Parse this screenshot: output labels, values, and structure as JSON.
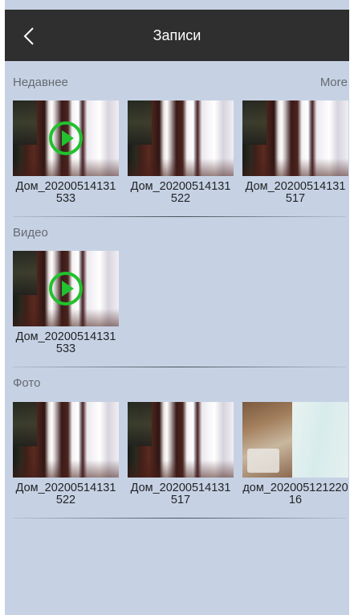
{
  "header": {
    "title": "Записи",
    "back_icon": "chevron-left-icon"
  },
  "recent": {
    "title": "Недавнее",
    "more_label": "More",
    "items": [
      {
        "caption": "Дом_20200514131533",
        "type": "video"
      },
      {
        "caption": "Дом_20200514131522",
        "type": "photo"
      },
      {
        "caption": "Дом_20200514131517",
        "type": "photo"
      }
    ]
  },
  "video": {
    "title": "Видео",
    "items": [
      {
        "caption": "Дом_20200514131533",
        "type": "video"
      }
    ]
  },
  "photo": {
    "title": "Фото",
    "items": [
      {
        "caption": "Дом_20200514131522",
        "type": "photo"
      },
      {
        "caption": "Дом_20200514131517",
        "type": "photo"
      },
      {
        "caption": "дом_20200512122016",
        "type": "photo"
      }
    ]
  },
  "colors": {
    "header_bg": "#2f2f2f",
    "screen_bg": "#c6d2e4",
    "play_accent": "#22c12e"
  }
}
